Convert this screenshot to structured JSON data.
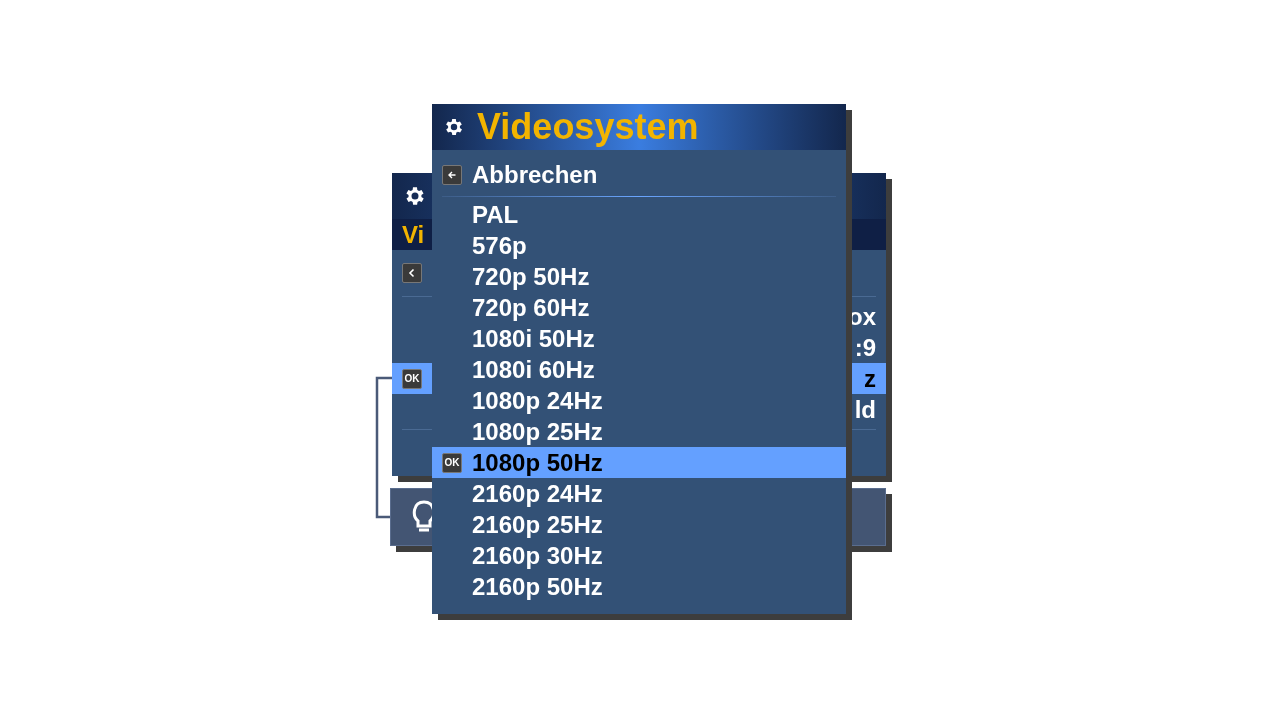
{
  "back_window": {
    "title_fragment": "Vi",
    "check_label": "OK",
    "values": [
      {
        "text": "ox",
        "selected": false
      },
      {
        "text": ":9",
        "selected": false
      },
      {
        "text": "z",
        "selected": true
      },
      {
        "text": "ld",
        "selected": false
      }
    ]
  },
  "dialog": {
    "title": "Videosystem",
    "cancel": "Abbrechen",
    "check_label": "OK",
    "options": [
      {
        "label": "PAL",
        "selected": false
      },
      {
        "label": "576p",
        "selected": false
      },
      {
        "label": "720p 50Hz",
        "selected": false
      },
      {
        "label": "720p 60Hz",
        "selected": false
      },
      {
        "label": "1080i 50Hz",
        "selected": false
      },
      {
        "label": "1080i 60Hz",
        "selected": false
      },
      {
        "label": "1080p 24Hz",
        "selected": false
      },
      {
        "label": "1080p 25Hz",
        "selected": false
      },
      {
        "label": "1080p 50Hz",
        "selected": true
      },
      {
        "label": "2160p 24Hz",
        "selected": false
      },
      {
        "label": "2160p 25Hz",
        "selected": false
      },
      {
        "label": "2160p 30Hz",
        "selected": false
      },
      {
        "label": "2160p 50Hz",
        "selected": false
      }
    ]
  }
}
